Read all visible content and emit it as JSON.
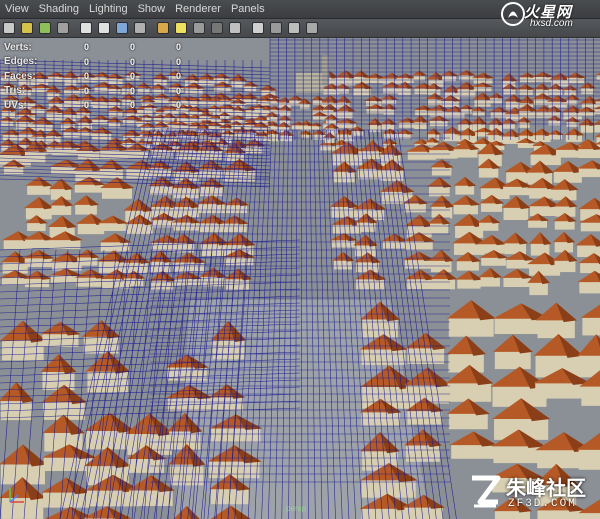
{
  "menu": [
    "View",
    "Shading",
    "Lighting",
    "Show",
    "Renderer",
    "Panels"
  ],
  "toolbar": {
    "icons": [
      "camera-icon",
      "bookmark-icon",
      "image-plane-icon",
      "grid-icon",
      "frame-all-icon",
      "frame-selected-icon",
      "wireframe-icon",
      "smooth-shade-icon",
      "texture-icon",
      "lights-icon",
      "shadow-icon",
      "ao-icon",
      "xray-icon",
      "isolate-icon",
      "resolution-gate-icon",
      "film-gate-icon",
      "safe-area-icon"
    ]
  },
  "hud": {
    "rows": [
      {
        "label": "Verts:",
        "values": [
          "0",
          "0",
          "0"
        ]
      },
      {
        "label": "Edges:",
        "values": [
          "0",
          "0",
          "0"
        ]
      },
      {
        "label": "Faces:",
        "values": [
          "0",
          "0",
          "0"
        ]
      },
      {
        "label": "Tris:",
        "values": [
          "0",
          "0",
          "0"
        ]
      },
      {
        "label": "UVs:",
        "values": [
          "0",
          "0",
          "0"
        ]
      }
    ]
  },
  "viewport": {
    "camera": "persp",
    "colors": {
      "roof": "#b55a26",
      "roof_dark": "#8a3f18",
      "wall": "#d8cfb2",
      "ground": "#8b9096",
      "wireframe": "#15158f"
    }
  },
  "watermarks": {
    "top_brand": "火星网",
    "top_site": "hxsd.com",
    "bottom_brand": "朱峰社区",
    "bottom_site": "ZF3D.COM"
  }
}
